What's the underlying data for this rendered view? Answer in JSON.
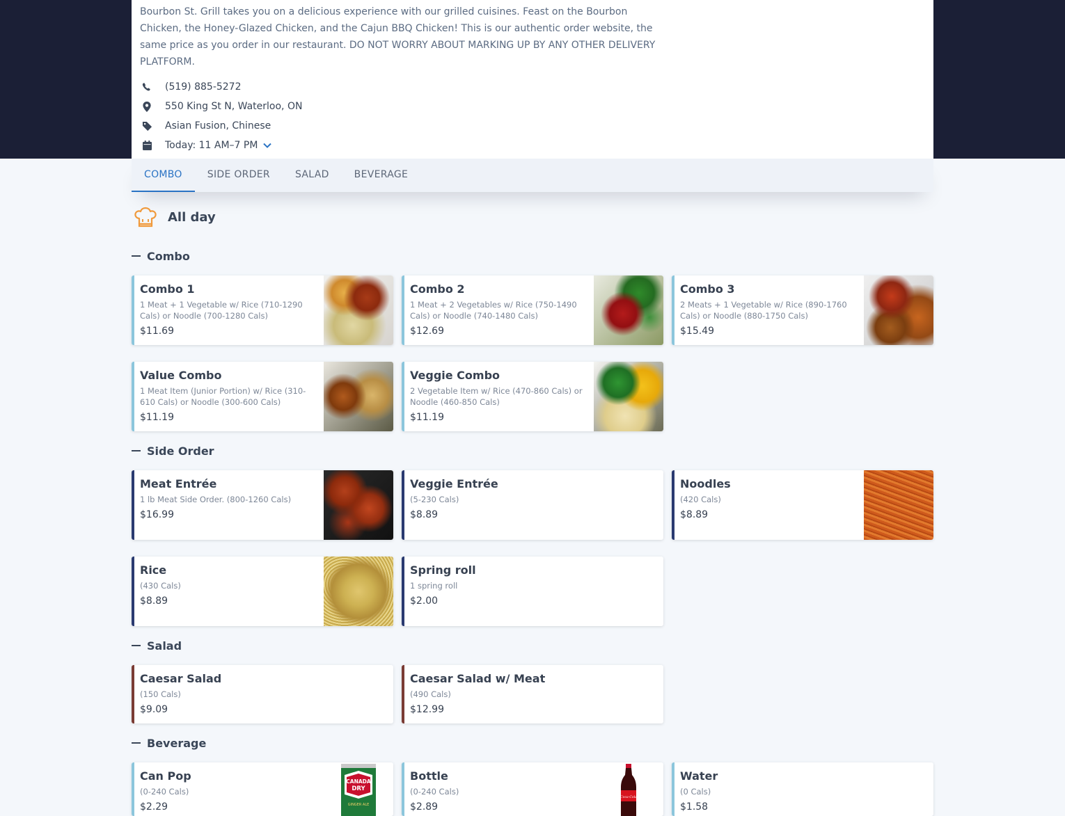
{
  "restaurant": {
    "description": "Bourbon St. Grill takes you on a delicious experience with our grilled cuisines. Feast on the Bourbon Chicken, the Honey-Glazed Chicken, and the Cajun BBQ Chicken! This is our authentic order website, the same price as you order in our restaurant. DO NOT WORRY ABOUT MARKING UP BY ANY OTHER DELIVERY PLATFORM.",
    "phone": "(519) 885-5272",
    "address": "550 King St N, Waterloo, ON",
    "cuisine": "Asian Fusion, Chinese",
    "hours": "Today: 11 AM–7 PM"
  },
  "icons": {
    "phone": "phone-icon",
    "address": "map-pin-icon",
    "cuisine": "tag-icon",
    "hours": "calendar-icon",
    "hours_toggle": "chevron-down-icon",
    "menu": "chef-hat-icon"
  },
  "colors": {
    "header_bg": "#1b1f36",
    "accent": "#2a73c4",
    "combo_border": "#8cc6dc",
    "side_border": "#2a3a70",
    "salad_border": "#7a3b34"
  },
  "tabs": [
    {
      "label": "COMBO",
      "active": true
    },
    {
      "label": "SIDE ORDER",
      "active": false
    },
    {
      "label": "SALAD",
      "active": false
    },
    {
      "label": "BEVERAGE",
      "active": false
    }
  ],
  "menu_title": "All day",
  "sections": {
    "combo": {
      "title": "Combo",
      "items": [
        {
          "name": "Combo 1",
          "desc": "1 Meat + 1 Vegetable w/ Rice (710-1290 Cals) or Noodle (700-1280 Cals)",
          "price": "$11.69"
        },
        {
          "name": "Combo 2",
          "desc": "1 Meat + 2 Vegetables w/ Rice (750-1490 Cals) or Noodle (740-1480 Cals)",
          "price": "$12.69"
        },
        {
          "name": "Combo 3",
          "desc": "2 Meats + 1 Vegetable w/ Rice (890-1760 Cals) or Noodle (880-1750 Cals)",
          "price": "$15.49"
        },
        {
          "name": "Value Combo",
          "desc": "1 Meat Item (Junior Portion) w/ Rice (310-610 Cals) or Noodle (300-600 Cals)",
          "price": "$11.19"
        },
        {
          "name": "Veggie Combo",
          "desc": "2 Vegetable Item w/ Rice (470-860 Cals) or Noodle (460-850 Cals)",
          "price": "$11.19"
        }
      ]
    },
    "side": {
      "title": "Side Order",
      "items": [
        {
          "name": "Meat Entrée",
          "desc": "1 lb Meat Side Order. (800-1260 Cals)",
          "price": "$16.99"
        },
        {
          "name": "Veggie Entrée",
          "desc": "(5-230 Cals)",
          "price": "$8.89"
        },
        {
          "name": "Noodles",
          "desc": "(420 Cals)",
          "price": "$8.89"
        },
        {
          "name": "Rice",
          "desc": "(430 Cals)",
          "price": "$8.89"
        },
        {
          "name": "Spring roll",
          "desc": "1 spring roll",
          "price": "$2.00"
        }
      ]
    },
    "salad": {
      "title": "Salad",
      "items": [
        {
          "name": "Caesar Salad",
          "desc": "(150 Cals)",
          "price": "$9.09"
        },
        {
          "name": "Caesar Salad w/ Meat",
          "desc": "(490 Cals)",
          "price": "$12.99"
        }
      ]
    },
    "beverage": {
      "title": "Beverage",
      "items": [
        {
          "name": "Can Pop",
          "desc": "(0-240 Cals)",
          "price": "$2.29"
        },
        {
          "name": "Bottle",
          "desc": "(0-240 Cals)",
          "price": "$2.89"
        },
        {
          "name": "Water",
          "desc": "(0 Cals)",
          "price": "$1.58"
        }
      ],
      "can_logo_text": [
        "CANADA",
        "DRY",
        "GINGER ALE"
      ],
      "bottle_logo_text": "Coca-Cola"
    }
  }
}
